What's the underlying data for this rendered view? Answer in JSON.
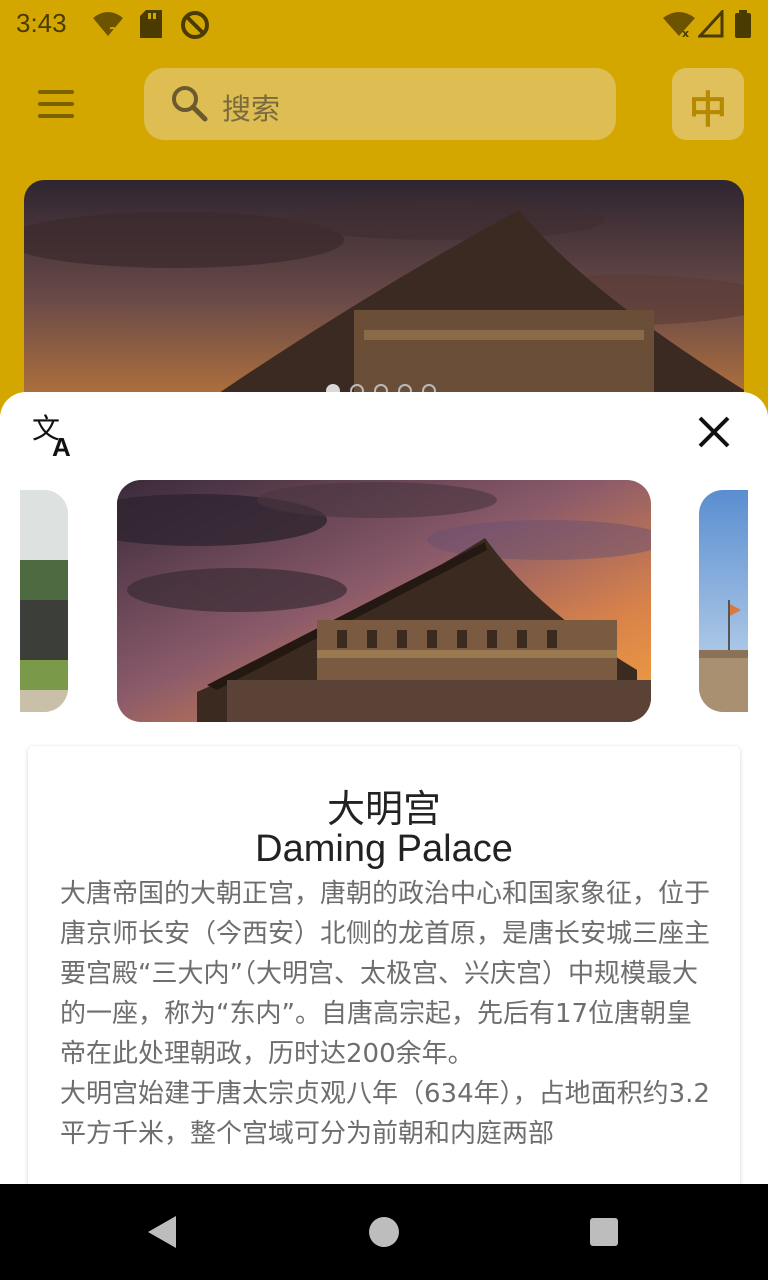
{
  "status_bar": {
    "time": "3:43",
    "icons": [
      "wifi-question-icon",
      "sd-card-icon",
      "sync-disabled-icon",
      "wifi-off-icon",
      "signal-icon",
      "battery-icon"
    ]
  },
  "app_bar": {
    "menu_icon": "hamburger-menu-icon",
    "search_placeholder": "搜索",
    "lang_button_label": "中",
    "background_color": "#d4a600"
  },
  "hero": {
    "carousel_dots": 5,
    "active_dot": 0
  },
  "sheet": {
    "translate_icon": "translate-icon",
    "close_icon": "close-icon",
    "title_zh": "大明宫",
    "title_en": "Daming Palace",
    "description": [
      "大唐帝国的大朝正宫，唐朝的政治中心和国家象征，位于唐京师长安（今西安）北侧的龙首原，是唐长安城三座主要宫殿“三大内”（大明宫、太极宫、兴庆宫）中规模最大的一座，称为“东内”。自唐高宗起，先后有17位唐朝皇帝在此处理朝政，历时达200余年。",
      "大明宫始建于唐太宗贞观八年（634年），占地面积约3.2平方千米，整个宫域可分为前朝和内庭两部"
    ]
  },
  "nav_bar": {
    "buttons": [
      "back-icon",
      "home-icon",
      "recents-icon"
    ]
  }
}
